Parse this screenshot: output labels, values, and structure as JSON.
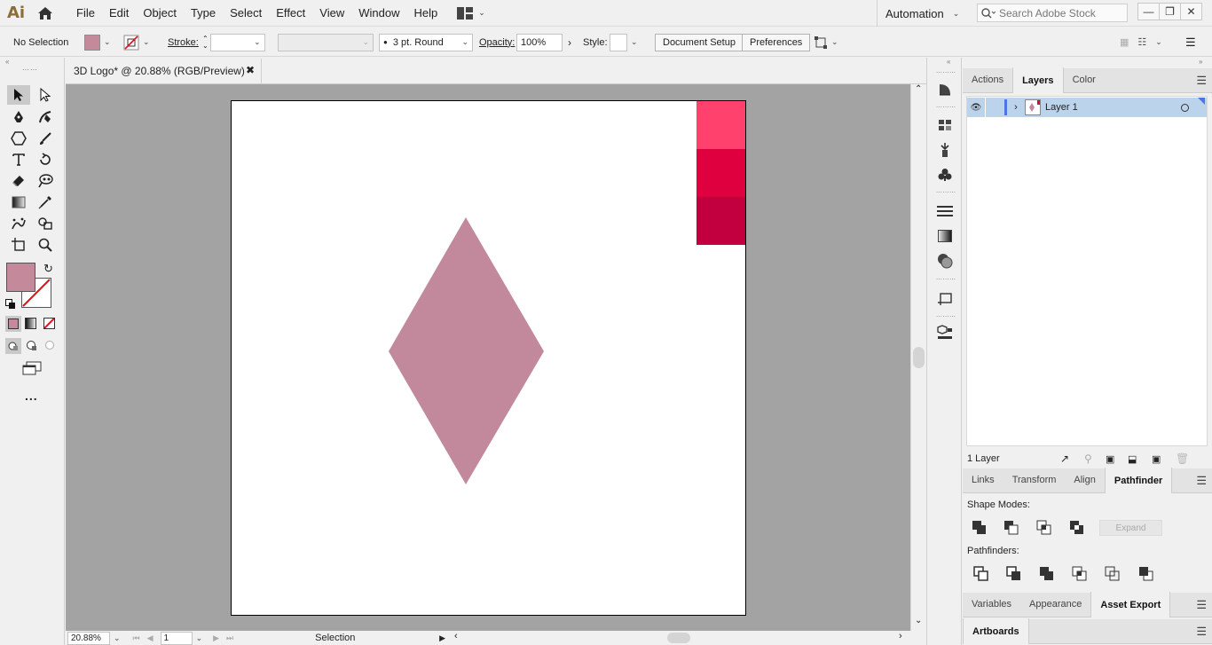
{
  "app": {
    "logo": "Ai",
    "menu": [
      "File",
      "Edit",
      "Object",
      "Type",
      "Select",
      "Effect",
      "View",
      "Window",
      "Help"
    ],
    "workspace": "Automation",
    "search_placeholder": "Search Adobe Stock"
  },
  "control_bar": {
    "selection": "No Selection",
    "fill_color": "#c4899b",
    "stroke_label": "Stroke:",
    "brush": "3 pt. Round",
    "opacity_label": "Opacity:",
    "opacity_value": "100%",
    "style_label": "Style:",
    "document_setup": "Document Setup",
    "preferences": "Preferences"
  },
  "document": {
    "tab_title": "3D Logo* @ 20.88% (RGB/Preview)",
    "zoom": "20.88%",
    "artboard_number": "1",
    "status_tool": "Selection",
    "shape_color": "#c2889b",
    "swatch_chips": [
      "#ff416e",
      "#de003f",
      "#c3003f"
    ]
  },
  "toolbar": {
    "fill_color": "#c4899b",
    "more_tools": "..."
  },
  "panels": {
    "top_tabs": [
      "Actions",
      "Layers",
      "Color"
    ],
    "active_top_tab": "Layers",
    "layer_name": "Layer 1",
    "layer_count": "1 Layer",
    "mid_tabs": [
      "Links",
      "Transform",
      "Align",
      "Pathfinder"
    ],
    "shape_modes_label": "Shape Modes:",
    "expand_label": "Expand",
    "pathfinders_label": "Pathfinders:",
    "bottom_tabs": [
      "Variables",
      "Appearance",
      "Asset Export"
    ],
    "last_tabs": [
      "Artboards"
    ]
  }
}
